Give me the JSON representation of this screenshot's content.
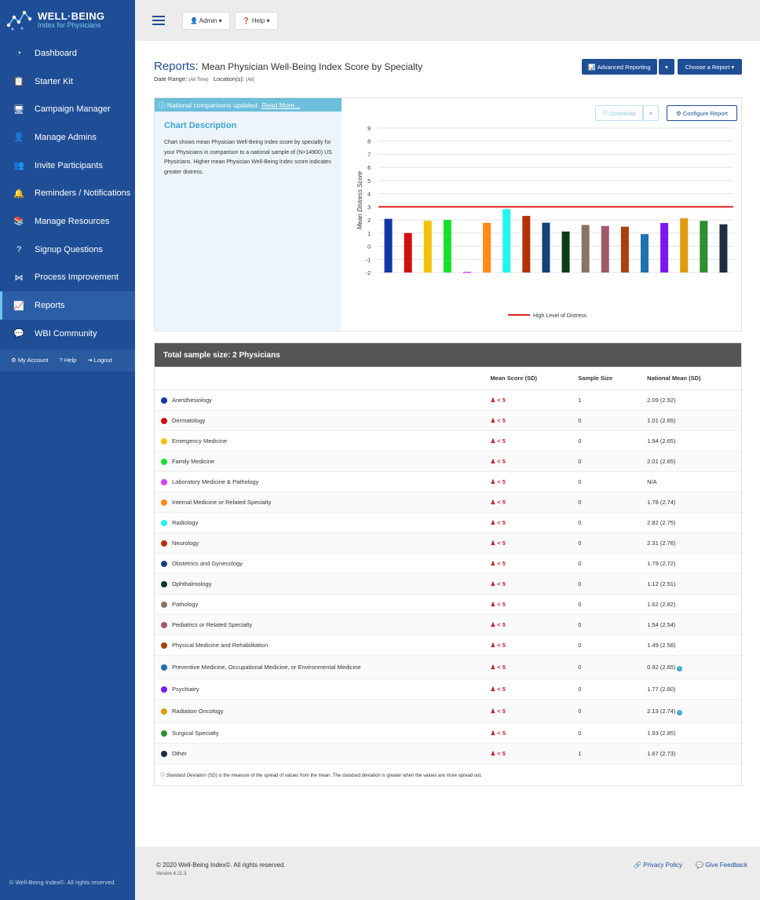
{
  "brand": {
    "title": "WELL·BEING",
    "subtitle": "Index for Physicians"
  },
  "sidebar": {
    "items": [
      {
        "label": "Dashboard",
        "icon": "dashboard-icon"
      },
      {
        "label": "Starter Kit",
        "icon": "clipboard-icon"
      },
      {
        "label": "Campaign Manager",
        "icon": "campaign-icon"
      },
      {
        "label": "Manage Admins",
        "icon": "admin-icon"
      },
      {
        "label": "Invite Participants",
        "icon": "users-icon"
      },
      {
        "label": "Reminders / Notifications",
        "icon": "bell-icon"
      },
      {
        "label": "Manage Resources",
        "icon": "books-icon"
      },
      {
        "label": "Signup Questions",
        "icon": "question-icon"
      },
      {
        "label": "Process Improvement",
        "icon": "share-icon"
      },
      {
        "label": "Reports",
        "icon": "reports-icon",
        "active": true
      },
      {
        "label": "WBI Community",
        "icon": "community-icon"
      }
    ],
    "account": {
      "my_account": "My Account",
      "help": "Help",
      "logout": "Logout"
    },
    "copyright": "© Well-Being Index©. All rights reserved."
  },
  "topbar": {
    "admin": "Admin",
    "help": "Help"
  },
  "header": {
    "title": "Reports:",
    "subtitle": "Mean Physician Well-Being Index Score by Specialty",
    "date_range_label": "Date Range:",
    "date_range_value": "(All Time)",
    "location_label": "Location(s):",
    "location_value": "(All)",
    "advanced_reporting": "Advanced Reporting",
    "choose_report": "Choose a Report"
  },
  "panel": {
    "notice": "National comparisons updated.",
    "notice_link": "Read More...",
    "desc_title": "Chart Description",
    "desc_text": "Chart shows mean Physician Well-Being Index score by specialty for your Physicians in comparison to a national sample of (N>14900) US Physicians. Higher mean Physician Well-Being Index score indicates greater distress.",
    "download": "Download",
    "configure": "Configure Report"
  },
  "chart_data": {
    "type": "bar",
    "ylabel": "Mean Distress Score",
    "ylim": [
      -2,
      9
    ],
    "yticks": [
      9,
      8,
      7,
      6,
      5,
      4,
      3,
      2,
      1,
      0,
      -1,
      -2
    ],
    "grid": true,
    "threshold": {
      "name": "High Level of Distress",
      "value": 3,
      "color": "#e02020"
    },
    "legend": "bottom-center",
    "categories": [
      "Anesthesiology",
      "Dermatology",
      "Emergency Medicine",
      "Family Medicine",
      "Laboratory Medicine & Pathology",
      "Internal Medicine or Related Specialty",
      "Radiology",
      "Neurology",
      "Obstetrics and Gynecology",
      "Ophthalmology",
      "Pathology",
      "Pediatrics or Related Specialty",
      "Physical Medicine and Rehabilitation",
      "Preventive Medicine, Occupational Medicine, or Environmental Medicine",
      "Psychiatry",
      "Radiation Oncology",
      "Surgical Specialty",
      "Other"
    ],
    "values": [
      2.09,
      1.01,
      1.94,
      2.01,
      -1.9,
      1.78,
      2.82,
      2.31,
      1.79,
      1.12,
      1.62,
      1.54,
      1.49,
      0.92,
      1.77,
      2.13,
      1.93,
      1.67
    ],
    "colors": [
      "#1138a8",
      "#d01010",
      "#f5c20a",
      "#18e02a",
      "#e040f0",
      "#ff8a14",
      "#22f5ee",
      "#b82e0a",
      "#18417a",
      "#0a3d16",
      "#8c7460",
      "#a05a6a",
      "#a84010",
      "#1f73b0",
      "#7a18f0",
      "#e09a10",
      "#2e8e30",
      "#1e2e3e"
    ]
  },
  "table": {
    "title": "Total sample size: 2 Physicians",
    "cols": [
      "Mean Score (SD)",
      "Sample Size",
      "National Mean (SD)"
    ],
    "rows": [
      {
        "name": "Anesthesiology",
        "mean": "< 5",
        "size": "1",
        "nat": "2.09 (2.92)"
      },
      {
        "name": "Dermatology",
        "mean": "< 5",
        "size": "0",
        "nat": "1.01 (2.65)"
      },
      {
        "name": "Emergency Medicine",
        "mean": "< 5",
        "size": "0",
        "nat": "1.94 (2.65)"
      },
      {
        "name": "Family Medicine",
        "mean": "< 5",
        "size": "0",
        "nat": "2.01 (2.65)"
      },
      {
        "name": "Laboratory Medicine & Pathology",
        "mean": "< 5",
        "size": "0",
        "nat": "N/A"
      },
      {
        "name": "Internal Medicine or Related Specialty",
        "mean": "< 5",
        "size": "0",
        "nat": "1.78 (2.74)"
      },
      {
        "name": "Radiology",
        "mean": "< 5",
        "size": "0",
        "nat": "2.82 (2.75)"
      },
      {
        "name": "Neurology",
        "mean": "< 5",
        "size": "0",
        "nat": "2.31 (2.76)"
      },
      {
        "name": "Obstetrics and Gynecology",
        "mean": "< 5",
        "size": "0",
        "nat": "1.79 (2.72)"
      },
      {
        "name": "Ophthalmology",
        "mean": "< 5",
        "size": "0",
        "nat": "1.12 (2.51)"
      },
      {
        "name": "Pathology",
        "mean": "< 5",
        "size": "0",
        "nat": "1.62 (2.82)"
      },
      {
        "name": "Pediatrics or Related Specialty",
        "mean": "< 5",
        "size": "0",
        "nat": "1.54 (2.54)"
      },
      {
        "name": "Physical Medicine and Rehabilitation",
        "mean": "< 5",
        "size": "0",
        "nat": "1.49 (2.58)"
      },
      {
        "name": "Preventive Medicine, Occupational Medicine, or Environmental Medicine",
        "mean": "< 5",
        "size": "0",
        "nat": "0.92 (2.65)",
        "info": true
      },
      {
        "name": "Psychiatry",
        "mean": "< 5",
        "size": "0",
        "nat": "1.77 (2.80)"
      },
      {
        "name": "Radiation Oncology",
        "mean": "< 5",
        "size": "0",
        "nat": "2.13 (2.74)",
        "info": true
      },
      {
        "name": "Surgical Specialty",
        "mean": "< 5",
        "size": "0",
        "nat": "1.93 (2.85)"
      },
      {
        "name": "Other",
        "mean": "< 5",
        "size": "1",
        "nat": "1.67 (2.73)"
      }
    ],
    "footnote_term": "Standard Deviation",
    "footnote_text": "(SD) is the measure of the spread of values from the mean. The standard deviation is greater when the values are more spread out."
  },
  "footer": {
    "copyright": "© 2020 Well-Being Index©. All rights reserved.",
    "version": "Version 4.21.3",
    "privacy": "Privacy Policy",
    "feedback": "Give Feedback"
  }
}
